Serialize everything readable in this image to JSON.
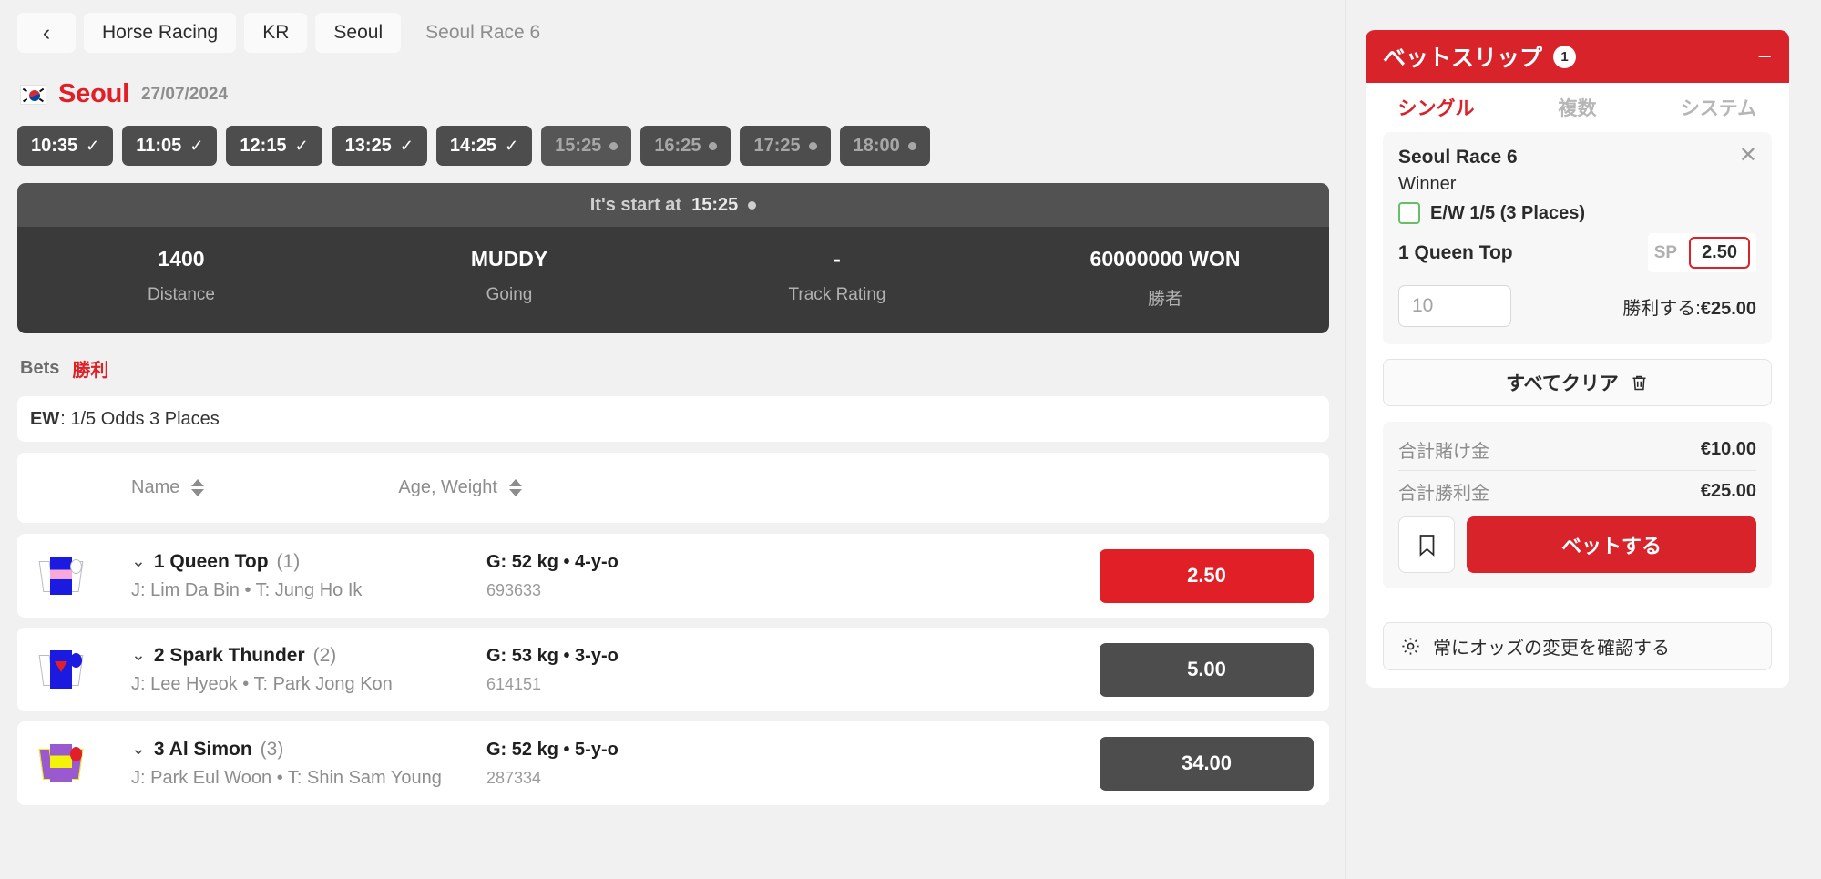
{
  "breadcrumb": {
    "back_icon": "chevron-left-icon",
    "items": [
      {
        "label": "Horse Racing",
        "active": true
      },
      {
        "label": "KR",
        "active": true
      },
      {
        "label": "Seoul",
        "active": true
      },
      {
        "label": "Seoul Race 6",
        "active": false
      }
    ]
  },
  "venue": {
    "flag_icon": "kr-flag-icon",
    "name": "Seoul",
    "date": "27/07/2024"
  },
  "times": [
    {
      "label": "10:35",
      "state": "done"
    },
    {
      "label": "11:05",
      "state": "done"
    },
    {
      "label": "12:15",
      "state": "done"
    },
    {
      "label": "13:25",
      "state": "done"
    },
    {
      "label": "14:25",
      "state": "done"
    },
    {
      "label": "15:25",
      "state": "current"
    },
    {
      "label": "16:25",
      "state": "upcoming"
    },
    {
      "label": "17:25",
      "state": "upcoming"
    },
    {
      "label": "18:00",
      "state": "upcoming"
    }
  ],
  "race": {
    "start_prefix": "It's start at",
    "start_time": "15:25",
    "stats": [
      {
        "value": "1400",
        "label": "Distance"
      },
      {
        "value": "MUDDY",
        "label": "Going"
      },
      {
        "value": "-",
        "label": "Track Rating"
      },
      {
        "value": "60000000 WON",
        "label": "勝者"
      }
    ]
  },
  "bets": {
    "label": "Bets",
    "value": "勝利",
    "ew_prefix": "EW",
    "ew_text": ": 1/5 Odds 3 Places"
  },
  "table": {
    "col_name": "Name",
    "col_age": "Age, Weight",
    "rows": [
      {
        "number_name": "1 Queen Top",
        "draw": "(1)",
        "jockey_trainer": "J: Lim Da Bin • T: Jung Ho Ik",
        "age_weight": "G: 52 kg • 4-y-o",
        "form": "693633",
        "odds": "2.50",
        "selected": true,
        "silk_body": "#1a1ae0",
        "silk_band": "#f7a8dd",
        "silk_cap": "#ffffff"
      },
      {
        "number_name": "2 Spark Thunder",
        "draw": "(2)",
        "jockey_trainer": "J: Lee Hyeok • T: Park Jong Kon",
        "age_weight": "G: 53 kg • 3-y-o",
        "form": "614151",
        "odds": "5.00",
        "selected": false,
        "silk_body": "#1a1ae0",
        "silk_band": "#e01f26",
        "silk_cap": "#1a1ae0"
      },
      {
        "number_name": "3 Al Simon",
        "draw": "(3)",
        "jockey_trainer": "J: Park Eul Woon • T: Shin Sam Young",
        "age_weight": "G: 52 kg • 5-y-o",
        "form": "287334",
        "odds": "34.00",
        "selected": false,
        "silk_body": "#9b59d0",
        "silk_band": "#f2f20a",
        "silk_cap": "#e01f26"
      }
    ]
  },
  "betslip": {
    "title": "ベットスリップ",
    "count": "1",
    "minimize_icon": "minus-icon",
    "tabs": [
      {
        "label": "シングル",
        "active": true
      },
      {
        "label": "複数",
        "active": false
      },
      {
        "label": "システム",
        "active": false
      }
    ],
    "bet": {
      "event": "Seoul Race 6",
      "close_icon": "close-icon",
      "market": "Winner",
      "ew_label": "E/W 1/5 (3 Places)",
      "ew_checked": false,
      "selection": "1 Queen Top",
      "sp_label": "SP",
      "odds": "2.50",
      "stake_placeholder": "10",
      "stake_value": "",
      "to_win_label": "勝利する:",
      "to_win_value": "€25.00"
    },
    "clear_all": "すべてクリア",
    "clear_icon": "trash-icon",
    "totals": [
      {
        "key": "合計賭け金",
        "value": "€10.00"
      },
      {
        "key": "合計勝利金",
        "value": "€25.00"
      }
    ],
    "bookmark_icon": "bookmark-icon",
    "place_bet": "ベットする",
    "odds_confirm": "常にオッズの変更を確認する",
    "odds_confirm_icon": "gear-icon"
  },
  "colors": {
    "brand_red": "#d8232a",
    "odds_red": "#e01f26",
    "dark": "#4d4d4d",
    "panel_dark": "#3a3a3a"
  }
}
